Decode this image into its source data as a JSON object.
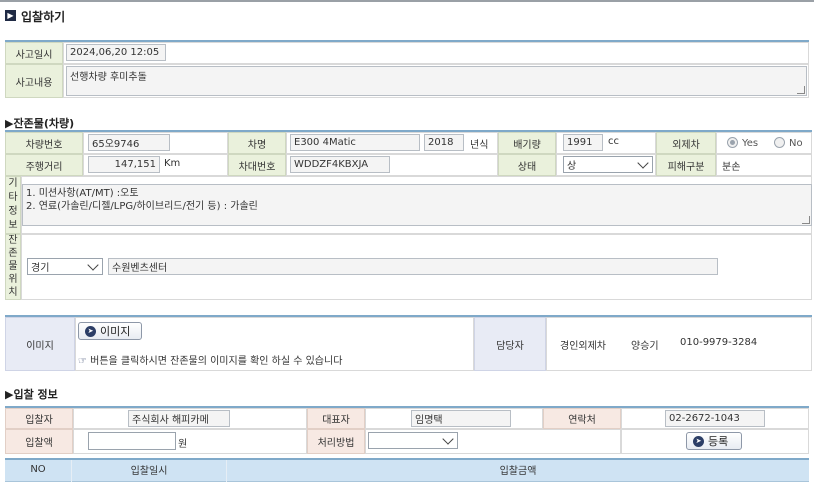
{
  "page": {
    "title": "입찰하기"
  },
  "accident": {
    "datetime_label": "사고일시",
    "datetime_value": "2024,06,20 12:05",
    "content_label": "사고내용",
    "content_value": "선행차량 후미추돌"
  },
  "vehicle_section": {
    "title": "▶잔존물(차량)"
  },
  "vehicle": {
    "plate_label": "차량번호",
    "plate_value": "65오9746",
    "name_label": "차명",
    "name_value": "E300 4Matic",
    "year_value": "2018",
    "year_unit": "년식",
    "displacement_label": "배기량",
    "displacement_value": "1991",
    "displacement_unit": "cc",
    "foreign_label": "외제차",
    "yes_label": "Yes",
    "no_label": "No",
    "foreign_selected": "Yes",
    "mileage_label": "주행거리",
    "mileage_value": "147,151",
    "mileage_unit": "Km",
    "vin_label": "차대번호",
    "vin_value": "WDDZF4KBXJA",
    "condition_label": "상태",
    "condition_value": "상",
    "damage_label": "피해구분",
    "damage_value": "분손"
  },
  "other_info": {
    "label_chars": [
      "기",
      "타",
      "정",
      "보"
    ],
    "line1": "1. 미션사항(AT/MT) :오토",
    "line2": "2. 연료(가솔린/디젤/LPG/하이브리드/전기 등) : 가솔린"
  },
  "location": {
    "label_chars": [
      "잔",
      "존",
      "물",
      "위",
      "치"
    ],
    "region_value": "경기",
    "detail_value": "수원벤츠센터"
  },
  "image_section": {
    "label": "이미지",
    "button_label": "이미지",
    "hint": "버튼을 클릭하시면 잔존물의 이미지를 확인 하실 수 있습니다",
    "manager_label": "담당자",
    "manager_company": "경인외제차",
    "manager_name": "양승기",
    "manager_phone": "010-9979-3284"
  },
  "bid_section": {
    "title": "▶입찰 정보"
  },
  "bid": {
    "bidder_label": "입찰자",
    "bidder_value": "주식회사 해피카메",
    "rep_label": "대표자",
    "rep_value": "임명택",
    "contact_label": "연락처",
    "contact_value": "02-2672-1043",
    "amount_label": "입찰액",
    "amount_value": "",
    "amount_unit": "원",
    "method_label": "처리방법",
    "method_value": "",
    "register_label": "등록"
  },
  "bid_table": {
    "columns": [
      "NO",
      "입찰일시",
      "입찰금액"
    ]
  },
  "colors": {
    "accent_blue": "#7fa9c9",
    "label_green": "#eaf1dc",
    "label_pink": "#f7e9e3",
    "header_blue": "#cfe3f3"
  }
}
